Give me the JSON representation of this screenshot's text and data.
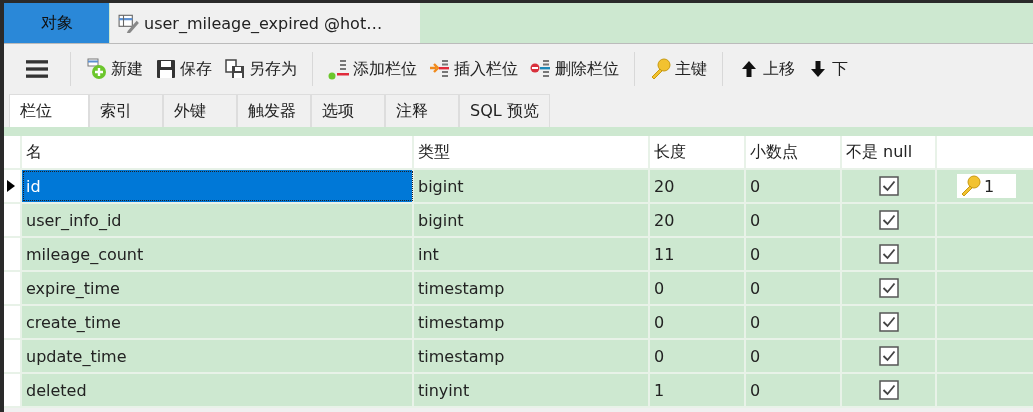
{
  "tabs": [
    {
      "label": "对象",
      "kind": "objects"
    },
    {
      "label": "user_mileage_expired @hot…",
      "kind": "designer"
    }
  ],
  "toolbar": [
    {
      "label": "新建",
      "kind": "new"
    },
    {
      "label": "保存",
      "kind": "save"
    },
    {
      "label": "另存为",
      "kind": "save-as"
    },
    {
      "label": "添加栏位",
      "kind": "add-field"
    },
    {
      "label": "插入栏位",
      "kind": "insert-field"
    },
    {
      "label": "删除栏位",
      "kind": "delete-field"
    },
    {
      "label": "主键",
      "kind": "primary-key"
    },
    {
      "label": "上移",
      "kind": "move-up"
    },
    {
      "label": "下",
      "kind": "move-down"
    }
  ],
  "subtabs": [
    {
      "label": "栏位",
      "selected": true
    },
    {
      "label": "索引",
      "selected": false
    },
    {
      "label": "外键",
      "selected": false
    },
    {
      "label": "触发器",
      "selected": false
    },
    {
      "label": "选项",
      "selected": false
    },
    {
      "label": "注释",
      "selected": false
    },
    {
      "label": "SQL 预览",
      "selected": false
    }
  ],
  "table": {
    "columns": [
      "名",
      "类型",
      "长度",
      "小数点",
      "不是 null"
    ],
    "rows": [
      {
        "name": "id",
        "type": "bigint",
        "length": "20",
        "decimals": "0",
        "not_null": true,
        "key": "1",
        "selected": true
      },
      {
        "name": "user_info_id",
        "type": "bigint",
        "length": "20",
        "decimals": "0",
        "not_null": true,
        "selected": false
      },
      {
        "name": "mileage_count",
        "type": "int",
        "length": "11",
        "decimals": "0",
        "not_null": true,
        "selected": false
      },
      {
        "name": "expire_time",
        "type": "timestamp",
        "length": "0",
        "decimals": "0",
        "not_null": true,
        "selected": false
      },
      {
        "name": "create_time",
        "type": "timestamp",
        "length": "0",
        "decimals": "0",
        "not_null": true,
        "selected": false
      },
      {
        "name": "update_time",
        "type": "timestamp",
        "length": "0",
        "decimals": "0",
        "not_null": true,
        "selected": false
      },
      {
        "name": "deleted",
        "type": "tinyint",
        "length": "1",
        "decimals": "0",
        "not_null": true,
        "selected": false
      }
    ]
  }
}
